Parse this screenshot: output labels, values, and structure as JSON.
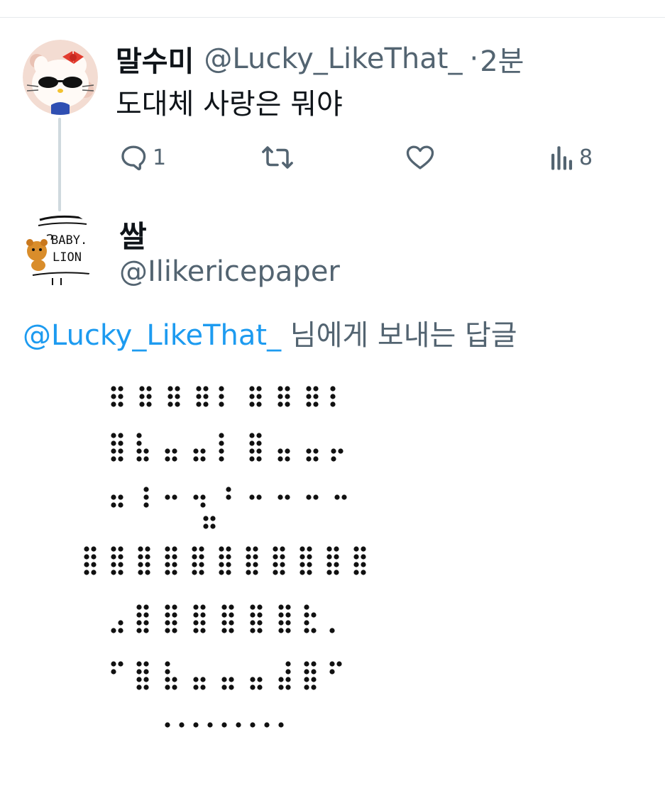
{
  "original_post": {
    "display_name": "말수미",
    "handle": "@Lucky_LikeThat_",
    "separator": "·",
    "time": "2분",
    "text": "도대체 사랑은 뭐야",
    "avatar_icon": "hello-kitty-sunglasses-avatar",
    "actions": {
      "reply_count": "1",
      "retweet_count": "",
      "like_count": "",
      "views_count": "8"
    }
  },
  "reply_post": {
    "display_name": "쌀",
    "handle": "@Ilikericepaper",
    "avatar_icon": "baby-lion-drawing-avatar",
    "replying_to_mention": "@Lucky_LikeThat_",
    "replying_to_suffix": " 님에게 보내는 답글"
  },
  "colors": {
    "link": "#1d9bf0",
    "secondary_text": "#536471",
    "primary_text": "#0f1419",
    "thread_line": "#cfd9de"
  }
}
